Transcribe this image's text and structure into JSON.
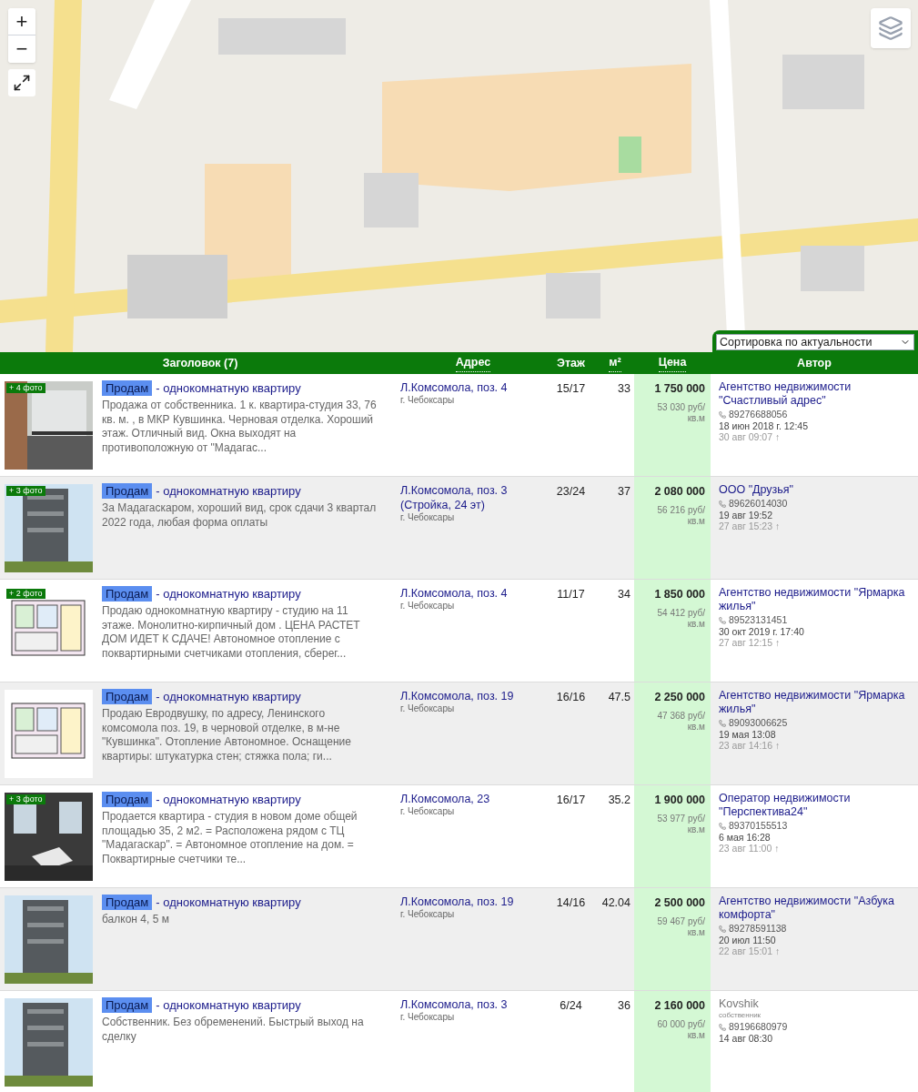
{
  "map": {
    "controls": [
      {
        "kind": "zoom_in",
        "label": "+"
      },
      {
        "kind": "zoom_out",
        "label": "−"
      },
      {
        "kind": "fullscreen"
      },
      {
        "kind": "layers"
      }
    ]
  },
  "sort": {
    "value": "Сортировка по актуальности"
  },
  "table": {
    "columns": [
      {
        "label": "Заголовок (7)",
        "link": false
      },
      {
        "label": "Адрес",
        "link": true
      },
      {
        "label": "Этаж",
        "link": false
      },
      {
        "label": "м²",
        "link": true
      },
      {
        "label": "Цена",
        "link": true
      },
      {
        "label": "Автор",
        "link": false
      }
    ],
    "rows": [
      {
        "photo_badge": "+ 4 фото",
        "tag": "Продам",
        "title": "- однокомнатную квартиру",
        "description": "Продажа от собственника. 1 к. квартира-студия 33, 76 кв. м. , в МКР Кувшинка. Черновая отделка. Хороший этаж. Отличный вид. Окна выходят на противоположную от \"Мадагас...",
        "address": "Л.Комсомола, поз. 4",
        "city": "г. Чебоксары",
        "floor": "15/17",
        "area": "33",
        "price": "1 750 000",
        "price_per_m": "53 030 руб/кв.м",
        "author": "Агентство недвижимости \"Счастливый адрес\"",
        "kind": "agency",
        "phone": "89276688056",
        "date": "18 июн 2018 г. 12:45",
        "updated": "30 авг 09:07 ↑"
      },
      {
        "photo_badge": "+ 3 фото",
        "tag": "Продам",
        "title": "- однокомнатную квартиру",
        "description": "За Мадагаскаром, хороший вид, срок сдачи 3 квартал 2022 года, любая форма оплаты",
        "address": "Л.Комсомола, поз. 3 (Стройка, 24 эт)",
        "city": "г. Чебоксары",
        "floor": "23/24",
        "area": "37",
        "price": "2 080 000",
        "price_per_m": "56 216 руб/кв.м",
        "author": "ООО \"Друзья\"",
        "kind": "agency",
        "phone": "89626014030",
        "date": "19 авг 19:52",
        "updated": "27 авг 15:23 ↑"
      },
      {
        "photo_badge": "+ 2 фото",
        "tag": "Продам",
        "title": "- однокомнатную квартиру",
        "description": "Продаю однокомнатную квартиру - студию  на 11 этаже. Монолитно-кирпичный дом . ЦЕНА РАСТЕТ ДОМ ИДЕТ К СДАЧЕ! Автономное отопление с поквартирными счетчиками отопления, сберег...",
        "address": "Л.Комсомола, поз. 4",
        "city": "г. Чебоксары",
        "floor": "11/17",
        "area": "34",
        "price": "1 850 000",
        "price_per_m": "54 412 руб/кв.м",
        "author": "Агентство недвижимости \"Ярмарка жилья\"",
        "kind": "agency",
        "phone": "89523131451",
        "date": "30 окт 2019 г. 17:40",
        "updated": "27 авг 12:15 ↑"
      },
      {
        "tag": "Продам",
        "title": "- однокомнатную квартиру",
        "description": "Продаю Евродвушку, по адресу, Ленинского комсомола поз. 19, в черновой отделке, в м-не \"Кувшинка\". Отопление Автономное. Оснащение квартиры: штукатурка стен; стяжка пола; ги...",
        "address": "Л.Комсомола, поз. 19",
        "city": "г. Чебоксары",
        "floor": "16/16",
        "area": "47.5",
        "price": "2 250 000",
        "price_per_m": "47 368 руб/кв.м",
        "author": "Агентство недвижимости \"Ярмарка жилья\"",
        "kind": "agency",
        "phone": "89093006625",
        "date": "19 мая 13:08",
        "updated": "23 авг 14:16 ↑"
      },
      {
        "photo_badge": "+ 3 фото",
        "tag": "Продам",
        "title": "- однокомнатную квартиру",
        "description": "Продается квартира - студия в новом доме общей площадью 35, 2 м2. = Расположена рядом с ТЦ \"Мадагаскар\". = Автономное отопление на дом. = Поквартирные счетчики те...",
        "address": "Л.Комсомола, 23",
        "city": "г. Чебоксары",
        "floor": "16/17",
        "area": "35.2",
        "price": "1 900 000",
        "price_per_m": "53 977 руб/кв.м",
        "author": "Оператор недвижимости \"Перспектива24\"",
        "kind": "agency",
        "phone": "89370155513",
        "date": "6 мая 16:28",
        "updated": "23 авг 11:00 ↑"
      },
      {
        "tag": "Продам",
        "title": "- однокомнатную квартиру",
        "description": "балкон 4, 5 м",
        "address": "Л.Комсомола, поз. 19",
        "city": "г. Чебоксары",
        "floor": "14/16",
        "area": "42.04",
        "price": "2 500 000",
        "price_per_m": "59 467 руб/кв.м",
        "author": "Агентство недвижимости \"Азбука комфорта\"",
        "kind": "agency",
        "phone": "89278591138",
        "date": "20 июл 11:50",
        "updated": "22 авг 15:01 ↑"
      },
      {
        "tag": "Продам",
        "title": "- однокомнатную квартиру",
        "description": "Собственник. Без обременений. Быстрый выход на сделку",
        "address": "Л.Комсомола, поз. 3",
        "city": "г. Чебоксары",
        "floor": "6/24",
        "area": "36",
        "price": "2 160 000",
        "price_per_m": "60 000 руб/кв.м",
        "author": "Kovshik",
        "kind": "owner",
        "author_note": "собственник",
        "phone": "89196680979",
        "date": "14 авг 08:30"
      }
    ]
  }
}
